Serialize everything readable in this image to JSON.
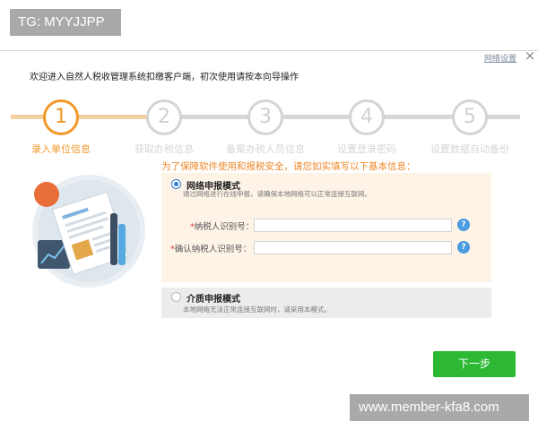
{
  "watermark": {
    "top_left": "TG: MYYJJPP",
    "bottom_right": "www.member-kfa8.com"
  },
  "window": {
    "net_settings": "网络设置",
    "close_label": "×",
    "welcome": "欢迎进入自然人税收管理系统扣缴客户端，初次使用请按本向导操作"
  },
  "steps": [
    {
      "number": "1",
      "label": "录入单位信息",
      "active": true
    },
    {
      "number": "2",
      "label": "获取办税信息",
      "active": false
    },
    {
      "number": "3",
      "label": "备案办税人员信息",
      "active": false
    },
    {
      "number": "4",
      "label": "设置登录密码",
      "active": false
    },
    {
      "number": "5",
      "label": "设置数据自动备份",
      "active": false
    }
  ],
  "form": {
    "prompt": "为了保障软件使用和报税安全，请您如实填写以下基本信息：",
    "online_mode": {
      "title": "网络申报模式",
      "desc": "通过网络进行在线申报，请确保本地网络可以正常连接互联网。",
      "selected": true
    },
    "fields": {
      "taxpayer_id_label": "纳税人识别号：",
      "taxpayer_id_value": "",
      "confirm_id_label": "确认纳税人识别号：",
      "confirm_id_value": "",
      "required_mark": "*",
      "help": "?"
    },
    "offline_mode": {
      "title": "介质申报模式",
      "desc": "本地网络无法正常连接互联网时，请采用本模式。",
      "selected": false
    }
  },
  "buttons": {
    "next": "下一步"
  },
  "colors": {
    "accent": "#f0982a",
    "primary_button": "#2db834",
    "help_icon": "#4a9be0",
    "online_panel": "#fdf3e7"
  }
}
